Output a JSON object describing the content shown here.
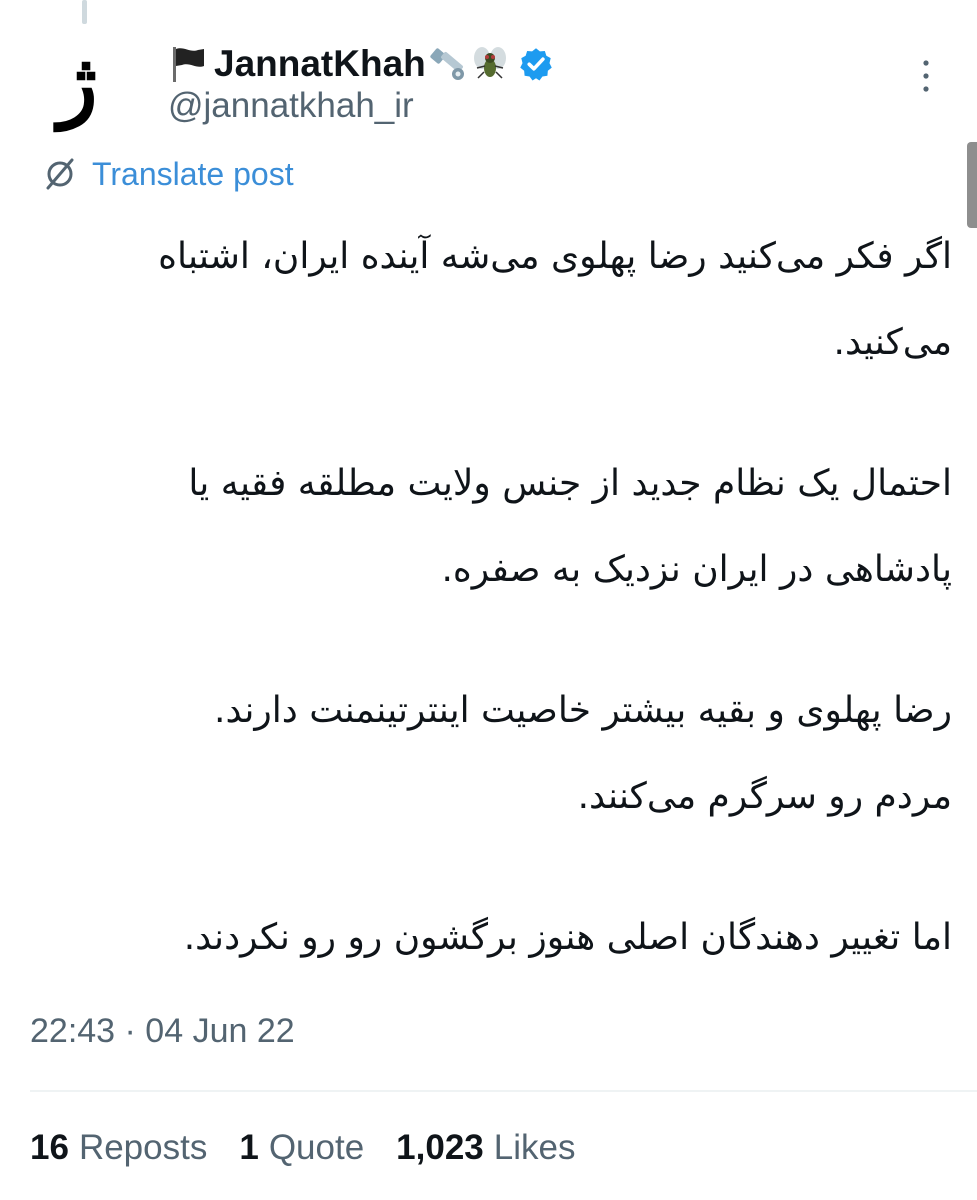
{
  "author": {
    "display_name": "JannatKhah",
    "handle": "@jannatkhah_ir",
    "avatar_letter": "ژ",
    "name_emojis": [
      "black-flag-icon",
      "nut-and-bolt-icon",
      "fly-icon"
    ],
    "verified": true
  },
  "translate_label": "Translate post",
  "post_lines": [
    [
      "اگر فکر می‌کنید رضا پهلوی می‌شه آینده ایران، اشتباه",
      "می‌کنید."
    ],
    [
      "احتمال یک نظام جدید از جنس ولایت مطلقه فقیه یا",
      "پادشاهی در ایران نزدیک به صفره."
    ],
    [
      "رضا پهلوی و بقیه بیشتر خاصیت اینترتینمنت دارند.",
      "مردم رو سرگرم می‌کنند."
    ],
    [
      "اما تغییر دهندگان اصلی هنوز برگشون رو رو نکردند."
    ]
  ],
  "timestamp": "22:43 · 04 Jun 22",
  "stats": {
    "reposts": {
      "count": "16",
      "label": "Reposts"
    },
    "quotes": {
      "count": "1",
      "label": "Quote"
    },
    "likes": {
      "count": "1,023",
      "label": "Likes"
    }
  },
  "colors": {
    "text": "#0f1419",
    "secondary": "#536471",
    "link": "#3b8ed8",
    "verified": "#1d9bf0"
  }
}
